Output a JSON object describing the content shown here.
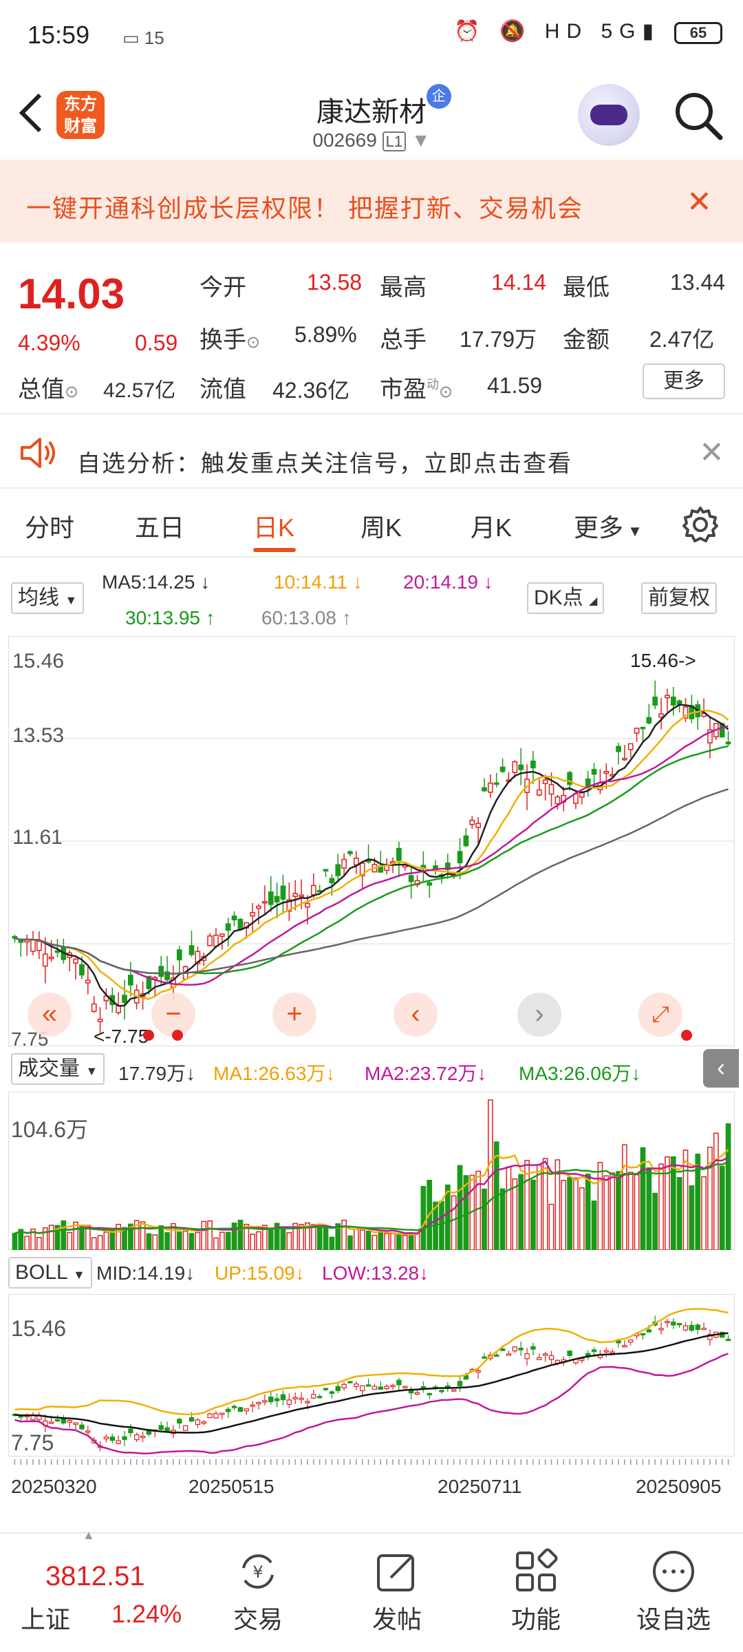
{
  "status": {
    "time": "15:59",
    "notif_count": "15",
    "battery": "65",
    "network": "5G"
  },
  "header": {
    "title": "康达新材",
    "badge": "企",
    "code": "002669",
    "level": "L1",
    "logo_line1": "东方",
    "logo_line2": "财富"
  },
  "promo": {
    "text": "一键开通科创成长层权限！ 把握打新、交易机会"
  },
  "quote": {
    "price": "14.03",
    "pct": "4.39%",
    "change": "0.59",
    "fields": [
      {
        "label": "今开",
        "value": "13.58",
        "color": "red"
      },
      {
        "label": "最高",
        "value": "14.14",
        "color": "red"
      },
      {
        "label": "最低",
        "value": "13.44",
        "color": "dark"
      },
      {
        "label": "换手",
        "value": "5.89%",
        "color": "dark"
      },
      {
        "label": "总手",
        "value": "17.79万",
        "color": "dark"
      },
      {
        "label": "金额",
        "value": "2.47亿",
        "color": "dark"
      },
      {
        "label": "总值",
        "value": "42.57亿",
        "color": "dark"
      },
      {
        "label": "流值",
        "value": "42.36亿",
        "color": "dark"
      },
      {
        "label": "市盈",
        "value": "41.59",
        "color": "dark"
      }
    ],
    "pe_sup": "动",
    "more": "更多"
  },
  "notice": {
    "text": "自选分析：触发重点关注信号，立即点击查看"
  },
  "tabs": [
    {
      "label": "分时",
      "active": false
    },
    {
      "label": "五日",
      "active": false
    },
    {
      "label": "日K",
      "active": true
    },
    {
      "label": "周K",
      "active": false
    },
    {
      "label": "月K",
      "active": false
    },
    {
      "label": "更多",
      "active": false
    }
  ],
  "ma": {
    "selector": "均线",
    "ma5": "MA5:14.25",
    "ma10": "10:14.11",
    "ma20": "20:14.19",
    "ma30": "30:13.95",
    "ma60": "60:13.08",
    "dk": "DK点",
    "adjust": "前复权"
  },
  "kchart": {
    "y_labels": [
      "15.46",
      "13.53",
      "11.61"
    ],
    "low_label": "7.75",
    "max_marker": "15.46->",
    "min_marker": "<-7.75"
  },
  "volume": {
    "selector": "成交量",
    "value": "17.79万",
    "ma1": "MA1:26.63万",
    "ma2": "MA2:23.72万",
    "ma3": "MA3:26.06万",
    "y_label": "104.6万"
  },
  "boll": {
    "selector": "BOLL",
    "mid": "MID:14.19",
    "up": "UP:15.09",
    "low": "LOW:13.28",
    "y_top": "15.46",
    "y_bottom": "7.75"
  },
  "dates": [
    "20250320",
    "20250515",
    "20250711",
    "20250905"
  ],
  "bottomnav": {
    "index_value": "3812.51",
    "index_name": "上证",
    "index_pct": "1.24%",
    "items": [
      "交易",
      "发帖",
      "功能",
      "设自选"
    ]
  },
  "colors": {
    "up": "#e02020",
    "down": "#1a9a1a",
    "accent": "#e8501e",
    "ma5": "#222222",
    "ma10": "#f0b000",
    "ma20": "#c0189a",
    "ma30": "#1a9a1a",
    "ma60": "#666666"
  }
}
